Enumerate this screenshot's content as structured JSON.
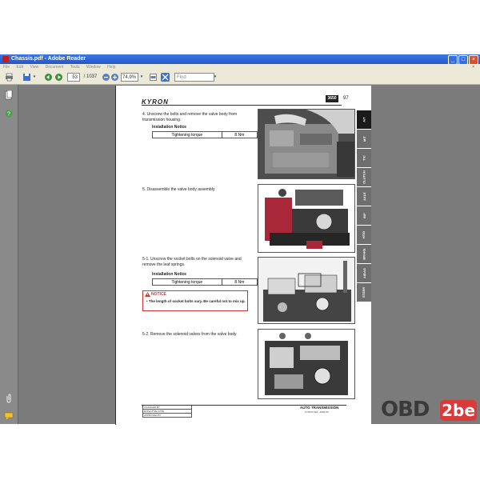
{
  "window": {
    "title": "Chassis.pdf - Adobe Reader",
    "buttons": {
      "minimize": "_",
      "maximize": "□",
      "close": "×"
    }
  },
  "menubar": {
    "items": [
      "File",
      "Edit",
      "View",
      "Document",
      "Tools",
      "Window",
      "Help"
    ],
    "close_glyph": "×"
  },
  "toolbar": {
    "page_current": "53",
    "page_total": "/ 1037",
    "zoom": "74,9%",
    "find_placeholder": "Find"
  },
  "page": {
    "header": {
      "logo": "KYRON",
      "model_code": "3650",
      "page_number": "97"
    },
    "tabs": [
      "A/T",
      "M/T",
      "T/C",
      "CLUTCH",
      "AXLE",
      "B/P",
      "HT/D",
      "BRAKE",
      "A/BAG",
      "STEER"
    ],
    "steps": [
      {
        "text": "4.  Unscrew the bolts and remove the valve body from transmission housing."
      },
      {
        "text": "5.  Disassemble the valve body assembly."
      },
      {
        "text": "5-1.  Unscrew the socket bolts on the solenoid valve and remove the leaf springs."
      },
      {
        "text": "5-2.  Remove the solenoid valves from the valve body."
      }
    ],
    "installation_notices": [
      {
        "title": "Installation Notice",
        "label": "Tightening torque",
        "value": "8 Nm"
      },
      {
        "title": "Installation Notice",
        "label": "Tightening torque",
        "value": "8 Nm"
      }
    ],
    "caution": {
      "title": "NOTICE",
      "body": "• The length of socket bolts vary. Be careful not to mix up."
    },
    "footer": {
      "rows": [
        "CHANGED BY",
        "EFFECTIVE DATE",
        "APPROVED BY"
      ],
      "title": "AUTO TRANSMISSION",
      "subtitle": "KYRON SM - 2005.09"
    }
  },
  "watermark": {
    "left": "OBD",
    "right": "2be"
  },
  "colors": {
    "titlebar": "#2f66d6",
    "viewer_bg": "#7b7b7b",
    "caution": "#cc3333",
    "brand_red": "#d93a3a"
  }
}
